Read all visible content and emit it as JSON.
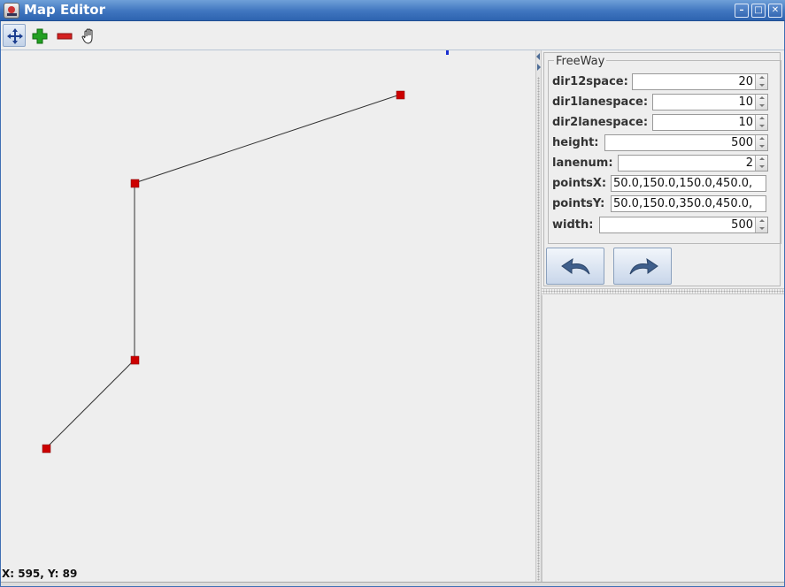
{
  "window": {
    "title": "Map Editor",
    "icon": "map-editor-app-icon",
    "controls": [
      {
        "name": "minimize-button",
        "glyph": "–"
      },
      {
        "name": "maximize-button",
        "glyph": "□"
      },
      {
        "name": "close-button",
        "glyph": "✕"
      }
    ]
  },
  "toolbar": {
    "tools": [
      {
        "name": "move-tool",
        "icon": "move-arrows-icon",
        "active": true
      },
      {
        "name": "add-point-tool",
        "icon": "plus-icon",
        "active": false
      },
      {
        "name": "remove-point-tool",
        "icon": "minus-icon",
        "active": false
      },
      {
        "name": "pan-tool",
        "icon": "hand-icon",
        "active": false
      }
    ]
  },
  "canvas": {
    "coord_readout": "X: 595, Y: 89",
    "node_color": "#cc0000",
    "edge_color": "#333333"
  },
  "properties": {
    "group_title": "FreeWay",
    "fields": [
      {
        "label": "dir12space:",
        "value": "20",
        "kind": "spinner"
      },
      {
        "label": "dir1lanespace:",
        "value": "10",
        "kind": "spinner"
      },
      {
        "label": "dir2lanespace:",
        "value": "10",
        "kind": "spinner"
      },
      {
        "label": "height:",
        "value": "500",
        "kind": "spinner"
      },
      {
        "label": "lanenum:",
        "value": "2",
        "kind": "spinner"
      },
      {
        "label": "pointsX:",
        "value": "50.0,150.0,150.0,450.0,",
        "kind": "text"
      },
      {
        "label": "pointsY:",
        "value": "50.0,150.0,350.0,450.0,",
        "kind": "text"
      },
      {
        "label": "width:",
        "value": "500",
        "kind": "spinner"
      }
    ],
    "buttons": [
      {
        "name": "undo-button",
        "icon": "undo-arrow-icon"
      },
      {
        "name": "redo-button",
        "icon": "redo-arrow-icon"
      }
    ]
  }
}
